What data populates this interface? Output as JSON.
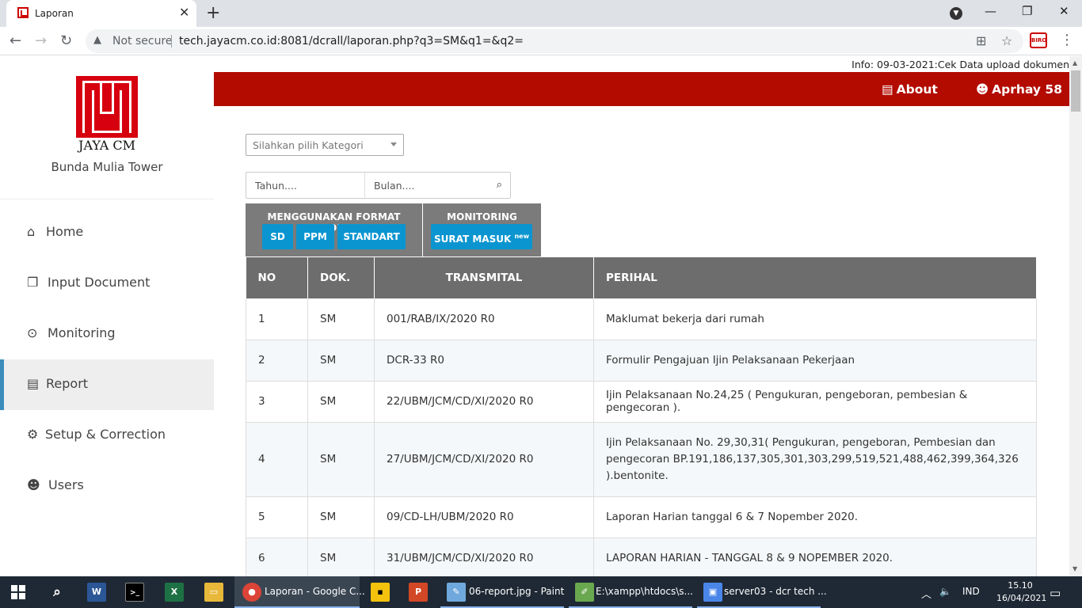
{
  "browser": {
    "tab_title": "Laporan",
    "not_secure": "Not secure",
    "url": "tech.jayacm.co.id:8081/dcrall/laporan.php?q3=SM&q1=&q2=",
    "ext_label": "BIRO"
  },
  "brand": {
    "logo_text": "JAYA CM",
    "subtitle": "Bunda Mulia Tower",
    "color": "#d7000f"
  },
  "sidebar": {
    "items": [
      {
        "label": "Home",
        "icon": "home-icon"
      },
      {
        "label": "Input Document",
        "icon": "documents-icon"
      },
      {
        "label": "Monitoring",
        "icon": "binoculars-icon"
      },
      {
        "label": "Report",
        "icon": "file-text-icon",
        "active": true
      },
      {
        "label": "Setup & Correction",
        "icon": "gear-icon"
      },
      {
        "label": "Users",
        "icon": "users-icon"
      }
    ]
  },
  "info": "Info: 09-03-2021:Cek Data upload dokumen",
  "topnav": {
    "about": "About",
    "user": "Aprhay 58",
    "color": "#b30b00"
  },
  "filter": {
    "category_placeholder": "Silahkan pilih Kategori",
    "year_placeholder": "Tahun....",
    "month_placeholder": "Bulan...."
  },
  "format_box": {
    "title": "MENGGUNAKAN FORMAT LAPORAN",
    "buttons": [
      "SD",
      "PPM",
      "STANDART"
    ]
  },
  "monitoring_box": {
    "title": "MONITORING",
    "button": "SURAT MASUK",
    "badge": "new"
  },
  "table": {
    "headers": [
      "NO",
      "DOK.",
      "TRANSMITAL",
      "PERIHAL"
    ],
    "rows": [
      [
        "1",
        "SM",
        "001/RAB/IX/2020 R0",
        "Maklumat bekerja dari rumah"
      ],
      [
        "2",
        "SM",
        "DCR-33 R0",
        "Formulir Pengajuan Ijin Pelaksanaan Pekerjaan"
      ],
      [
        "3",
        "SM",
        "22/UBM/JCM/CD/XI/2020 R0",
        "Ijin Pelaksanaan No.24,25 ( Pengukuran, pengeboran, pembesian & pengecoran )."
      ],
      [
        "4",
        "SM",
        "27/UBM/JCM/CD/XI/2020 R0",
        "Ijin Pelaksanaan No. 29,30,31( Pengukuran, pengeboran, Pembesian dan pengecoran BP.191,186,137,305,301,303,299,519,521,488,462,399,364,326 ).bentonite."
      ],
      [
        "5",
        "SM",
        "09/CD-LH/UBM/2020 R0",
        "Laporan Harian tanggal 6 & 7 Nopember 2020."
      ],
      [
        "6",
        "SM",
        "31/UBM/JCM/CD/XI/2020 R0",
        "LAPORAN HARIAN - TANGGAL 8 & 9 NOPEMBER 2020."
      ]
    ]
  },
  "taskbar": {
    "items": [
      {
        "label": "Laporan - Google C..."
      },
      {
        "label": "06-report.jpg - Paint"
      },
      {
        "label": "E:\\xampp\\htdocs\\s..."
      },
      {
        "label": "server03 - dcr tech ..."
      }
    ],
    "lang": "IND",
    "time": "15.10",
    "date": "16/04/2021"
  }
}
